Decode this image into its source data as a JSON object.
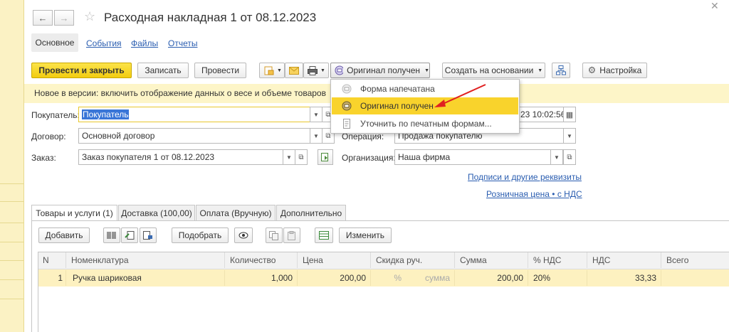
{
  "window": {
    "title": "Расходная накладная 1 от 08.12.2023",
    "close_icon": "close-icon"
  },
  "nav": {
    "back_icon": "arrow-left-icon",
    "forward_icon": "arrow-right-icon",
    "star_icon": "star-icon"
  },
  "section_tabs": {
    "main": "Основное",
    "events": "События",
    "files": "Файлы",
    "reports": "Отчеты"
  },
  "toolbar": {
    "post_close": "Провести и закрыть",
    "save": "Записать",
    "post": "Провести",
    "original_status": "Оригинал получен",
    "create_based": "Создать на основании",
    "settings": "Настройка"
  },
  "notice": "Новое в версии: включить отображение данных о весе и объеме товаров можно",
  "popup": {
    "items": [
      {
        "label": "Форма напечатана",
        "icon": "printed-form-icon"
      },
      {
        "label": "Оригинал получен",
        "icon": "original-received-icon"
      },
      {
        "label": "Уточнить по печатным формам...",
        "icon": "document-icon"
      }
    ]
  },
  "form": {
    "buyer_label": "Покупатель:",
    "buyer_value": "Покупатель",
    "contract_label": "Договор:",
    "contract_value": "Основной договор",
    "order_label": "Заказ:",
    "order_value": "Заказ покупателя 1 от 08.12.2023",
    "date_value": "23 10:02:56",
    "operation_label": "Операция:",
    "operation_value": "Продажа покупателю",
    "org_label": "Организация:",
    "org_value": "Наша фирма",
    "signatures_link": "Подписи и другие реквизиты",
    "price_link": "Розничная цена • с НДС"
  },
  "tabs": [
    "Товары и услуги (1)",
    "Доставка (100,00)",
    "Оплата (Вручную)",
    "Дополнительно"
  ],
  "table_toolbar": {
    "add": "Добавить",
    "pick": "Подобрать",
    "change": "Изменить"
  },
  "table": {
    "headers": [
      "N",
      "Номенклатура",
      "Количество",
      "Цена",
      "Скидка руч.",
      "Сумма",
      "% НДС",
      "НДС",
      "Всего"
    ],
    "rows": [
      {
        "n": "1",
        "item": "Ручка шариковая",
        "qty": "1,000",
        "price": "200,00",
        "disc_pct": "%",
        "disc_sum": "сумма",
        "sum": "200,00",
        "vat_rate": "20%",
        "vat": "33,33",
        "total": ""
      }
    ]
  },
  "colors": {
    "accent_yellow": "#f9d32c",
    "notice_bg": "#fdf5c8",
    "link": "#2a5db0",
    "arrow_red": "#e02020"
  }
}
